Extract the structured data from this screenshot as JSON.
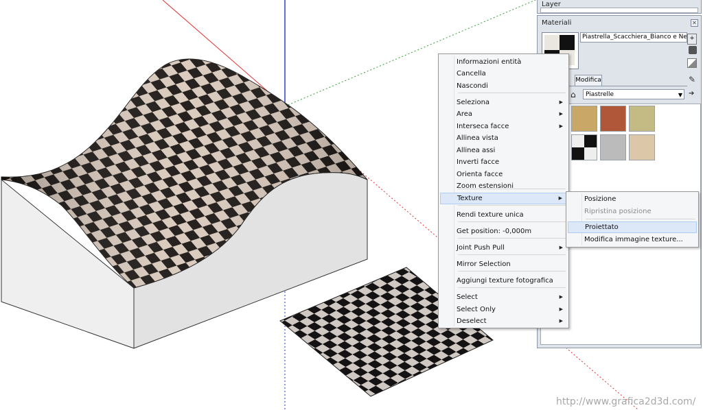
{
  "layer_panel": {
    "title": "Layer"
  },
  "materials_panel": {
    "title": "Materiali",
    "material_name": "Piastrella_Scacchiera_Bianco e Nero",
    "tab_edit": "Modifica",
    "library": "Piastrelle",
    "swatches": [
      {
        "name": "tile-diamond-swatch",
        "color": "#b7935a"
      },
      {
        "name": "tile-sand-swatch",
        "color": "#c9a867"
      },
      {
        "name": "tile-terracotta-swatch",
        "color": "#b0573a"
      },
      {
        "name": "tile-beige-swatch",
        "color": "#c4ba83"
      },
      {
        "name": "tile-granite-swatch",
        "color": "#9a5548"
      },
      {
        "name": "tile-checker-swatch",
        "color": "#222222"
      },
      {
        "name": "tile-grey-swatch",
        "color": "#bbbbbb"
      },
      {
        "name": "tile-marble-swatch",
        "color": "#dcc8a8"
      }
    ]
  },
  "context_menu": {
    "items": [
      {
        "label": "Informazioni entità",
        "submenu": false
      },
      {
        "label": "Cancella",
        "submenu": false
      },
      {
        "label": "Nascondi",
        "submenu": false
      },
      {
        "label": "Seleziona",
        "submenu": true
      },
      {
        "label": "Area",
        "submenu": true
      },
      {
        "label": "Interseca facce",
        "submenu": true
      },
      {
        "label": "Allinea vista",
        "submenu": false
      },
      {
        "label": "Allinea assi",
        "submenu": false
      },
      {
        "label": "Inverti facce",
        "submenu": false
      },
      {
        "label": "Orienta facce",
        "submenu": false
      },
      {
        "label": "Zoom estensioni",
        "submenu": false
      },
      {
        "label": "Texture",
        "submenu": true
      },
      {
        "label": "Rendi texture unica",
        "submenu": false
      },
      {
        "label": "Get position: -0,000m",
        "submenu": false
      },
      {
        "label": "Joint Push Pull",
        "submenu": true
      },
      {
        "label": "Mirror Selection",
        "submenu": false
      },
      {
        "label": "Aggiungi texture fotografica",
        "submenu": false
      },
      {
        "label": "Select",
        "submenu": true
      },
      {
        "label": "Select Only",
        "submenu": true
      },
      {
        "label": "Deselect",
        "submenu": true
      }
    ]
  },
  "texture_submenu": {
    "items": [
      {
        "label": "Posizione",
        "enabled": true
      },
      {
        "label": "Ripristina posizione",
        "enabled": false
      },
      {
        "label": "Proiettato",
        "enabled": true
      },
      {
        "label": "Modifica immagine texture...",
        "enabled": true
      }
    ]
  },
  "watermark": "http://www.grafica2d3d.com/",
  "colors": {
    "axis_red": "#e03030",
    "axis_green": "#30a030",
    "axis_blue": "#2030d0",
    "checker_dark": "#1a1512",
    "checker_light": "#d9c9bc"
  }
}
